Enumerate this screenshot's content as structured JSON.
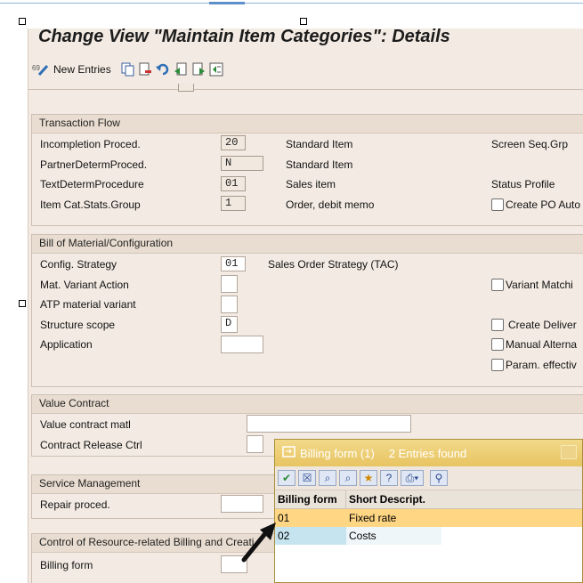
{
  "window": {
    "title": "Change View \"Maintain Item Categories\": Details"
  },
  "toolbar": {
    "new_entries_label": "New Entries",
    "icons": [
      "display-change-icon",
      "new-entries-icon",
      "copy-icon",
      "delete-icon",
      "undo-icon",
      "prev-entry-icon",
      "next-entry-icon",
      "select-icon"
    ]
  },
  "transaction_flow": {
    "title": "Transaction Flow",
    "rows": [
      {
        "label": "Incompletion Proced.",
        "value": "20",
        "desc": "Standard Item"
      },
      {
        "label": "PartnerDetermProced.",
        "value": "N",
        "desc": "Standard Item"
      },
      {
        "label": "TextDetermProcedure",
        "value": "01",
        "desc": "Sales item"
      },
      {
        "label": "Item Cat.Stats.Group",
        "value": "1",
        "desc": "Order, debit memo"
      }
    ],
    "screen_seq_label": "Screen Seq.Grp",
    "status_profile_label": "Status Profile",
    "create_po_label": "Create PO Auto"
  },
  "bom_config": {
    "title": "Bill of Material/Configuration",
    "config_strategy_label": "Config. Strategy",
    "config_strategy_value": "01",
    "config_strategy_desc": "Sales Order Strategy (TAC)",
    "mat_variant_label": "Mat. Variant Action",
    "atp_label": "ATP material variant",
    "structure_scope_label": "Structure scope",
    "structure_scope_value": "D",
    "application_label": "Application",
    "variant_matching_label": "Variant Matchi",
    "create_delivery_label": "Create Deliver",
    "manual_alt_label": "Manual Alterna",
    "param_effective_label": "Param. effectiv"
  },
  "value_contract": {
    "title": "Value Contract",
    "matl_label": "Value contract matl",
    "release_label": "Contract Release Ctrl"
  },
  "service_mgmt": {
    "title": "Service Management",
    "repair_label": "Repair proced."
  },
  "resource_billing": {
    "title": "Control of Resource-related Billing and Creati",
    "billing_form_label": "Billing form"
  },
  "popup": {
    "title": "Billing form (1)",
    "entries_found": "2 Entries found",
    "col1": "Billing form",
    "col2": "Short Descript.",
    "rows": [
      {
        "code": "01",
        "desc": "Fixed rate"
      },
      {
        "code": "02",
        "desc": "Costs"
      }
    ],
    "colors": {
      "title_bg": "#e8c462",
      "selected_row": "#ffd683",
      "alt_row": "#c6e4ef"
    }
  }
}
